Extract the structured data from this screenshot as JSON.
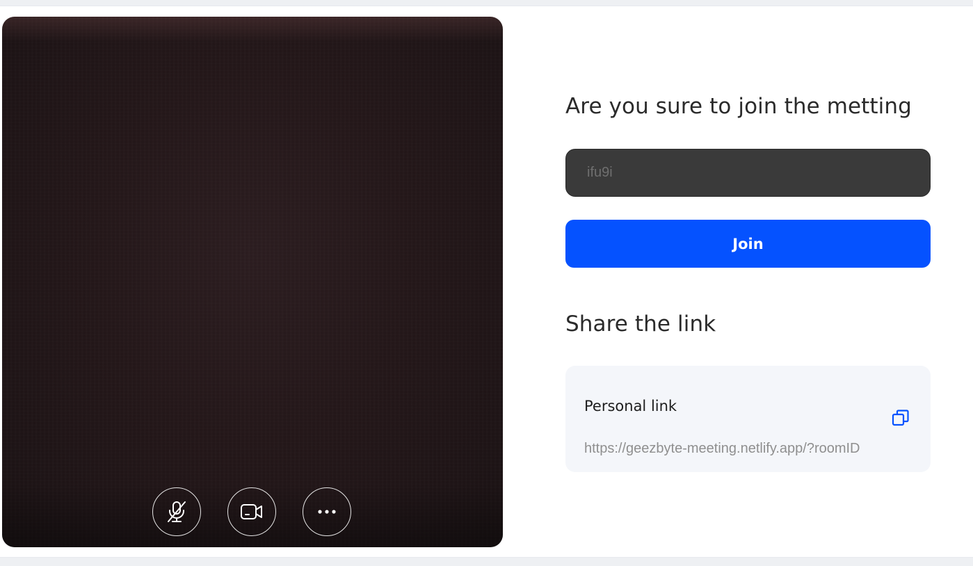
{
  "video": {
    "controls": {
      "mic_icon": "mic-off-icon",
      "camera_icon": "video-camera-icon",
      "more_icon": "more-horizontal-icon"
    }
  },
  "join": {
    "heading": "Are you sure to join the metting",
    "name_input_placeholder": "ifu9i",
    "join_label": "Join"
  },
  "share": {
    "heading": "Share the link",
    "card_title": "Personal link",
    "url": "https://geezbyte-meeting.netlify.app/?roomID",
    "copy_icon": "copy-icon"
  },
  "colors": {
    "primary": "#0552ff",
    "input_bg": "#3a3a3a",
    "card_bg": "#f4f6fa",
    "video_bg": "#231719"
  }
}
